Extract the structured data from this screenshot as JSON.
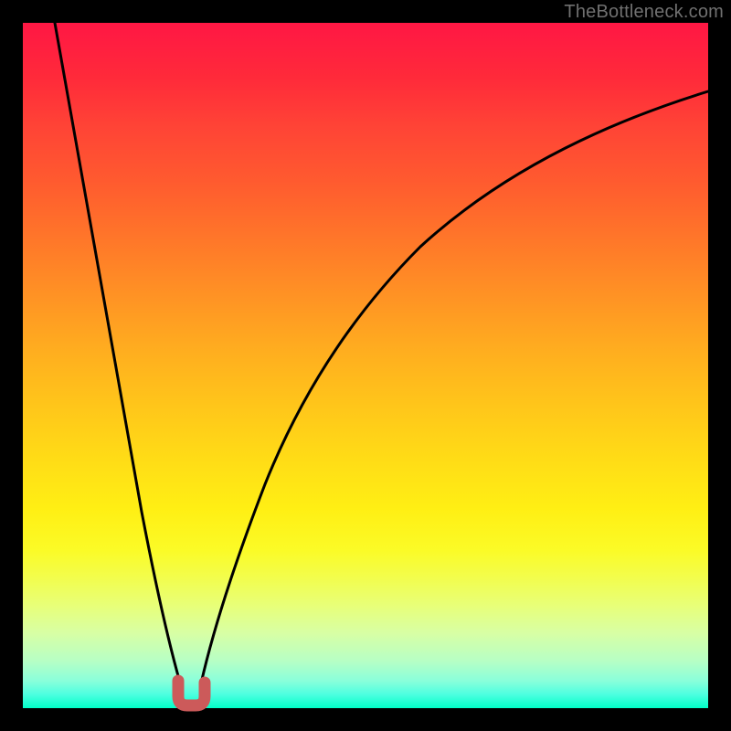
{
  "watermark": "TheBottleneck.com",
  "chart_data": {
    "type": "line",
    "title": "",
    "xlabel": "",
    "ylabel": "",
    "xlim": [
      0,
      100
    ],
    "ylim": [
      0,
      100
    ],
    "notes": "Bottleneck-style V-curve on a vertical red→green gradient. Y-axis descends visually (red high at top, green low at bottom). The curve bottoms out near x≈23 indicating the optimal balance point. No numeric axis ticks are rendered in the image; values are estimated from relative positions.",
    "series": [
      {
        "name": "Bottleneck curve",
        "x": [
          4,
          8,
          12,
          16,
          20,
          22,
          23,
          24,
          25,
          26,
          30,
          36,
          44,
          54,
          66,
          80,
          100
        ],
        "y": [
          100,
          82,
          64,
          46,
          22,
          6,
          0,
          0,
          2,
          6,
          20,
          38,
          54,
          68,
          79,
          87,
          93
        ]
      }
    ],
    "marker": {
      "name": "Optimal point (U-shaped marker)",
      "x_range": [
        22,
        25
      ],
      "y": 0,
      "color": "#cc5a5a"
    },
    "gradient_stops": [
      {
        "pos": 0,
        "color": "#ff1744"
      },
      {
        "pos": 50,
        "color": "#ffc61a"
      },
      {
        "pos": 80,
        "color": "#f2fd4d"
      },
      {
        "pos": 100,
        "color": "#00ffc8"
      }
    ]
  }
}
